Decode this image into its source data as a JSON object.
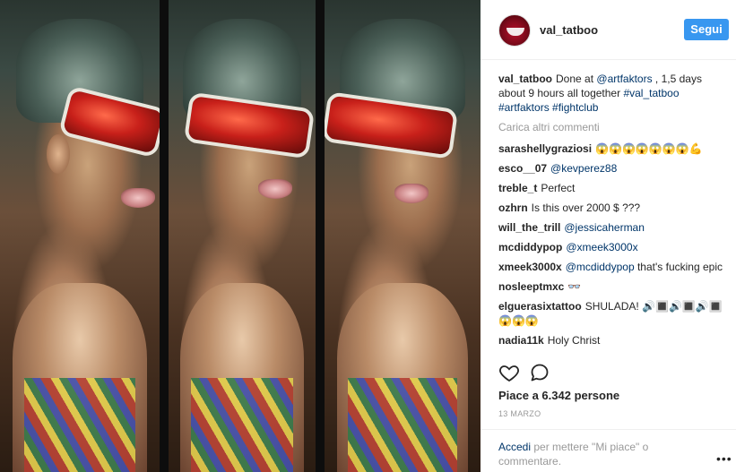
{
  "post": {
    "username": "val_tatboo",
    "follow_label": "Segui",
    "caption": {
      "user": "val_tatboo",
      "text_1": "Done at ",
      "mention": "@artfaktors",
      "text_2": " , 1,5 days about 9 hours all together ",
      "tag_1": "#val_tatboo",
      "tag_2": "#artfaktors",
      "tag_3": "#fightclub"
    },
    "load_more": "Carica altri commenti",
    "comments": [
      {
        "user": "sarashellygraziosi",
        "text": "😱😱😱😱😱😱😱💪",
        "link": ""
      },
      {
        "user": "esco__07",
        "text": "",
        "link": "@kevperez88"
      },
      {
        "user": "treble_t",
        "text": "Perfect",
        "link": ""
      },
      {
        "user": "ozhrn",
        "text": "Is this over 2000 $ ???",
        "link": ""
      },
      {
        "user": "will_the_trill",
        "text": "",
        "link": "@jessicaherman"
      },
      {
        "user": "mcdiddypop",
        "text": "",
        "link": "@xmeek3000x"
      },
      {
        "user": "xmeek3000x",
        "text": "that's fucking epic",
        "link": "@mcdiddypop"
      },
      {
        "user": "nosleeptmxc",
        "text": "👓",
        "link": ""
      },
      {
        "user": "elguerasixtattoo",
        "text": "SHULADA! 🔊🔳🔊🔳🔊🔳😱😱😱",
        "link": ""
      },
      {
        "user": "nadia11k",
        "text": "Holy Christ",
        "link": ""
      }
    ],
    "likes_text": "Piace a 6.342 persone",
    "date": "13 MARZO",
    "login_link": "Accedi",
    "login_text": " per mettere \"Mi piace\" o commentare.",
    "more_options": "•••"
  },
  "icons": {
    "like": "heart-icon",
    "comment": "comment-icon",
    "options": "more-options-icon"
  },
  "colors": {
    "follow_button": "#3897f0",
    "link": "#003569",
    "muted": "#999999"
  }
}
